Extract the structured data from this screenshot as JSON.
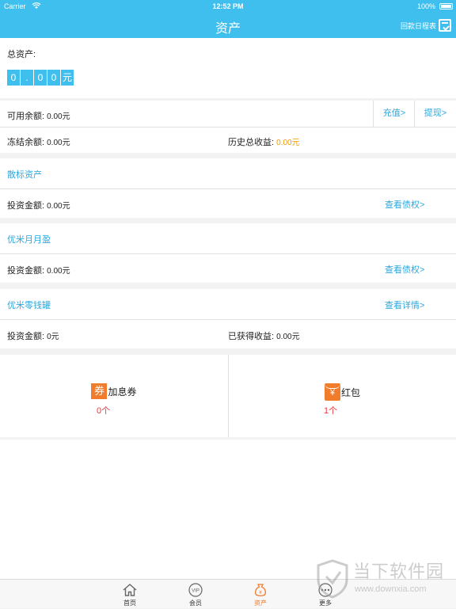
{
  "status_bar": {
    "carrier": "Carrier",
    "time": "12:52 PM",
    "battery": "100%"
  },
  "nav": {
    "title": "资产",
    "calendar_label": "回款日程表"
  },
  "total": {
    "label": "总资产:",
    "digits": [
      "0",
      ".",
      "0",
      "0"
    ],
    "unit": "元"
  },
  "balance": {
    "available_label": "可用余额:",
    "available_value": "0.00元",
    "recharge": "充值>",
    "withdraw": "提现>",
    "frozen_label": "冻结余额:",
    "frozen_value": "0.00元",
    "history_label": "历史总收益:",
    "history_value": "0.00元"
  },
  "sanbiao": {
    "title": "散标资产",
    "invest_label": "投资金额:",
    "invest_value": "0.00元",
    "link": "查看债权>"
  },
  "yueyueying": {
    "title": "优米月月盈",
    "invest_label": "投资金额:",
    "invest_value": "0.00元",
    "link": "查看债权>"
  },
  "piggy": {
    "title": "优米零钱罐",
    "link": "查看详情>",
    "invest_label": "投资金额:",
    "invest_value": "0元",
    "earned_label": "已获得收益:",
    "earned_value": "0.00元"
  },
  "coupons": [
    {
      "badge": "券",
      "name": "加息券",
      "count": "0个"
    },
    {
      "badge": "¥",
      "name": "红包",
      "count": "1个"
    }
  ],
  "tabs": [
    {
      "label": "首页",
      "icon": "home-icon"
    },
    {
      "label": "会员",
      "icon": "vip-icon"
    },
    {
      "label": "资产",
      "icon": "money-bag-icon"
    },
    {
      "label": "更多",
      "icon": "more-icon"
    }
  ],
  "watermark": {
    "title": "当下软件园",
    "url": "www.downxia.com"
  },
  "colors": {
    "brand": "#3fbfee",
    "link": "#2aa8e0",
    "orange": "#f39800",
    "red": "#e8383d",
    "badge": "#f07c2c"
  }
}
